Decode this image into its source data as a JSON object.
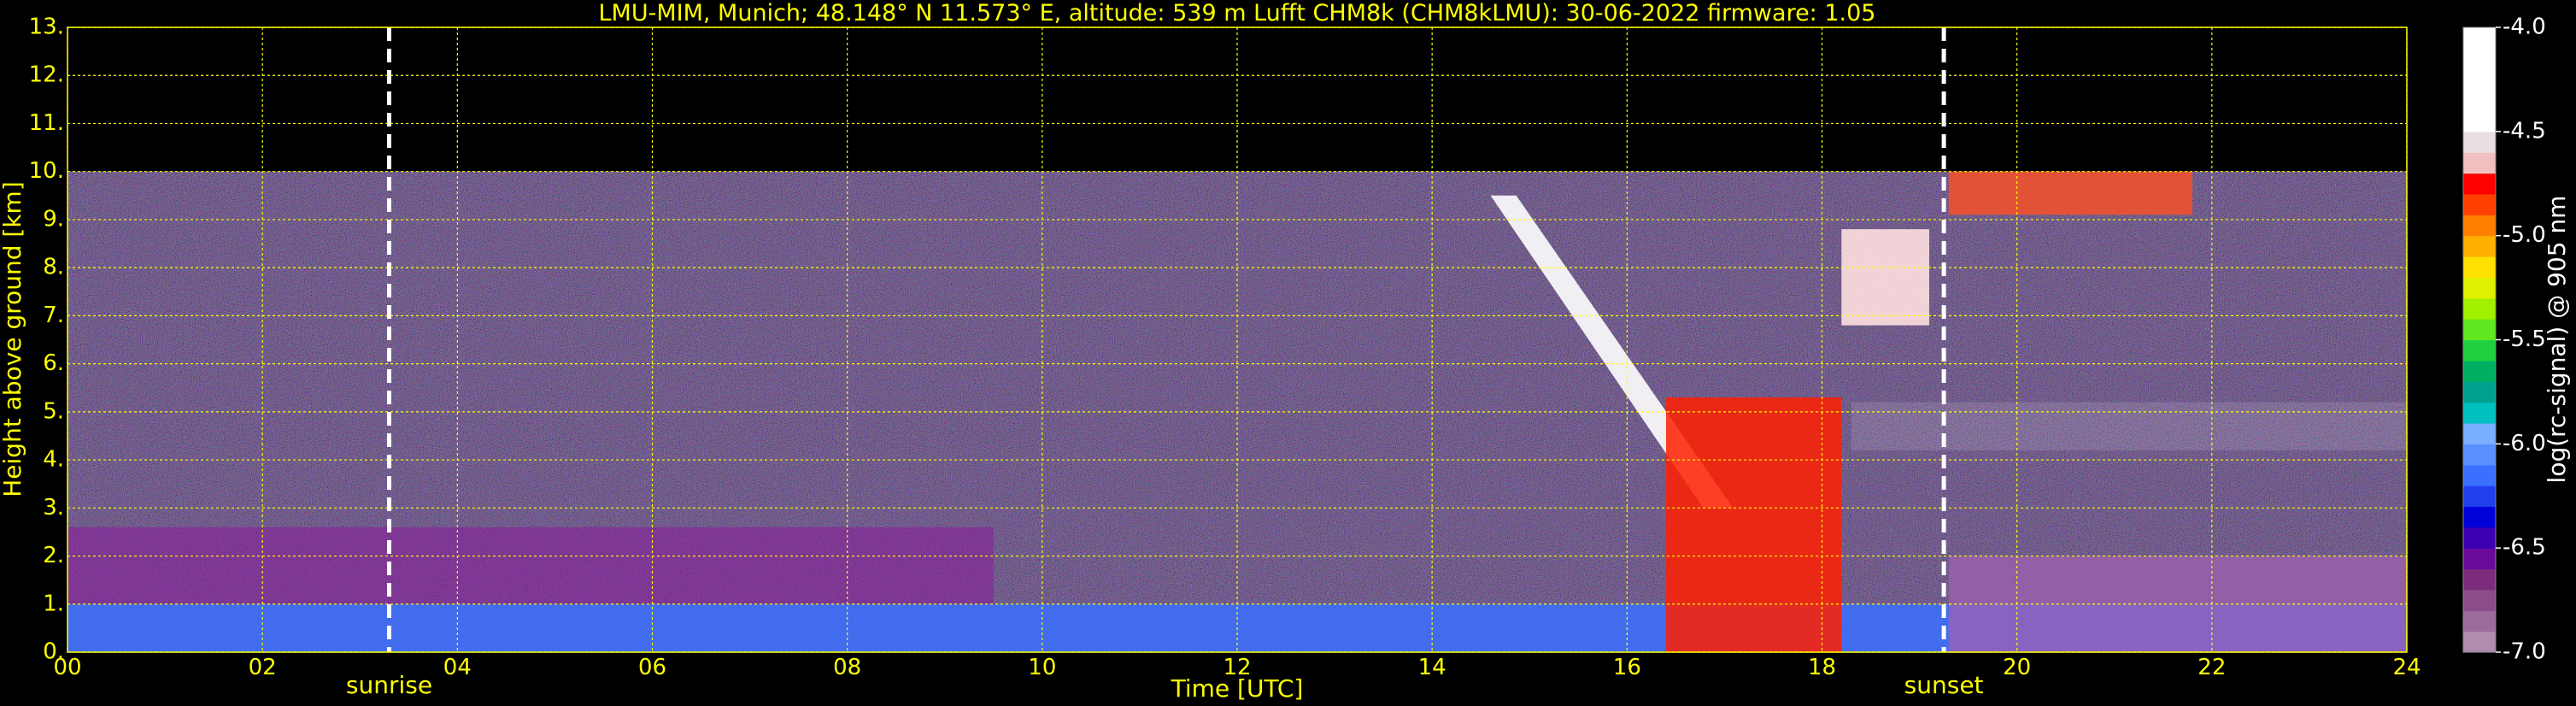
{
  "chart_data": {
    "type": "heatmap",
    "title": "LMU-MIM, Munich; 48.148° N 11.573° E, altitude: 539 m    Lufft CHM8k (CHM8kLMU): 30-06-2022    firmware: 1.05",
    "xlabel": "Time [UTC]",
    "ylabel": "Height above ground [km]",
    "xlim": [
      0,
      24
    ],
    "ylim": [
      0,
      13
    ],
    "x_ticks": [
      "00",
      "02",
      "04",
      "06",
      "08",
      "10",
      "12",
      "14",
      "16",
      "18",
      "20",
      "22",
      "24"
    ],
    "y_ticks": [
      "0.",
      "1.",
      "2.",
      "3.",
      "4.",
      "5.",
      "6.",
      "7.",
      "8.",
      "9.",
      "10.",
      "11.",
      "12.",
      "13."
    ],
    "grid": true,
    "measurement_top_km": 10,
    "markers": [
      {
        "label": "sunrise",
        "time": 3.3
      },
      {
        "label": "sunset",
        "time": 19.25
      }
    ],
    "colorbar": {
      "label": "log(rc-signal) @ 905 nm",
      "range": [
        -7.0,
        -4.0
      ],
      "ticks": [
        "-4.0",
        "-4.5",
        "-5.0",
        "-5.5",
        "-6.0",
        "-6.5",
        "-7.0"
      ],
      "colors": [
        "#b08cb0",
        "#9c6c9c",
        "#8c4c8c",
        "#7c2c7c",
        "#6a0a9c",
        "#3c00b0",
        "#0000d8",
        "#2040f0",
        "#3a70ff",
        "#5a90ff",
        "#7ab0ff",
        "#00c0c0",
        "#00a090",
        "#00b060",
        "#20d040",
        "#60e820",
        "#a0f000",
        "#e0f000",
        "#ffe000",
        "#ffb000",
        "#ff8000",
        "#ff4000",
        "#ff0000",
        "#f0c0c0",
        "#e8e0e0",
        "#ffffff",
        "#ffffff",
        "#ffffff",
        "#ffffff",
        "#ffffff"
      ]
    },
    "features": [
      {
        "name": "boundary-layer-aerosol",
        "t0": 0,
        "t1": 24,
        "h0": 0,
        "h1": 1.0
      },
      {
        "name": "residual-layer",
        "t0": 0,
        "t1": 9.5,
        "h0": 1.0,
        "h1": 2.6
      },
      {
        "name": "descending-cirrus-band",
        "t0": 14.6,
        "t1": 17.0,
        "h0": 9.5,
        "h1": 3.0
      },
      {
        "name": "convective-cloud",
        "t0": 16.4,
        "t1": 18.2,
        "h0": 0,
        "h1": 5.3
      },
      {
        "name": "high-cloud-streaks",
        "t0": 18.2,
        "t1": 19.1,
        "h0": 6.8,
        "h1": 8.8
      },
      {
        "name": "cirrus-top",
        "t0": 19.3,
        "t1": 21.8,
        "h0": 9.1,
        "h1": 10.0
      },
      {
        "name": "mid-level-cloud-5km",
        "t0": 18.3,
        "t1": 24,
        "h0": 4.2,
        "h1": 5.2
      },
      {
        "name": "evening-layer",
        "t0": 19.3,
        "t1": 24,
        "h0": 0,
        "h1": 2.0
      }
    ]
  }
}
